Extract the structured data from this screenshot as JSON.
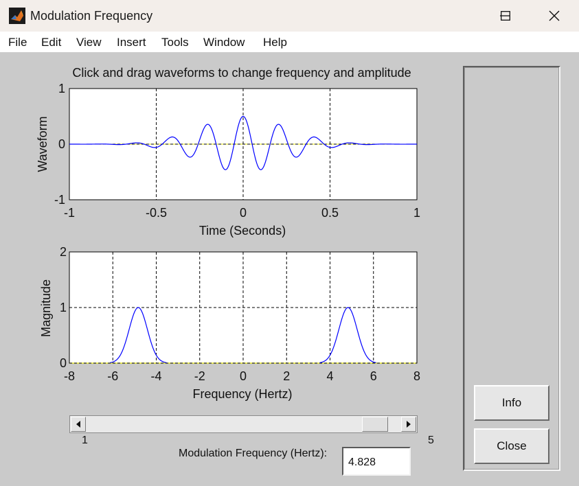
{
  "window": {
    "title": "Modulation Frequency",
    "controls": {
      "minimize": "minimize-icon",
      "maximize": "maximize-icon",
      "close": "close-icon"
    }
  },
  "menu": [
    "File",
    "Edit",
    "View",
    "Insert",
    "Tools",
    "Window",
    "Help"
  ],
  "instruction": "Click and drag waveforms to change frequency and amplitude",
  "waveform_plot": {
    "ylabel": "Waveform",
    "xlabel": "Time (Seconds)",
    "xticks": [
      "-1",
      "-0.5",
      "0",
      "0.5",
      "1"
    ],
    "yticks": [
      "1",
      "0",
      "-1"
    ]
  },
  "spectrum_plot": {
    "ylabel": "Magnitude",
    "xlabel": "Frequency (Hertz)",
    "xticks": [
      "-8",
      "-6",
      "-4",
      "-2",
      "0",
      "2",
      "4",
      "6",
      "8"
    ],
    "yticks": [
      "2",
      "1",
      "0"
    ]
  },
  "slider": {
    "min_label": "1",
    "max_label": "5",
    "value": 4.828
  },
  "freq_field": {
    "label": "Modulation Frequency (Hertz):",
    "value": "4.828"
  },
  "buttons": {
    "info": "Info",
    "close": "Close"
  },
  "colors": {
    "trace": "#0000ff",
    "zero_line": "#e8e800",
    "client_bg": "#cacaca"
  },
  "chart_data": [
    {
      "type": "line",
      "xlabel": "Time (Seconds)",
      "ylabel": "Waveform",
      "xlim": [
        -1,
        1
      ],
      "ylim": [
        -1,
        1
      ],
      "grid": true,
      "series": [
        {
          "description_formula": "0.5*exp(-8*t^2)*cos(2*pi*4.828*t)",
          "carrier_hz": 4.828,
          "peak": 0.5
        }
      ]
    },
    {
      "type": "line",
      "xlabel": "Frequency (Hertz)",
      "ylabel": "Magnitude",
      "xlim": [
        -8,
        8
      ],
      "ylim": [
        0,
        2
      ],
      "grid": true,
      "series": [
        {
          "peaks_at": [
            -4.828,
            4.828
          ],
          "peak_value": 1.0
        }
      ]
    }
  ]
}
